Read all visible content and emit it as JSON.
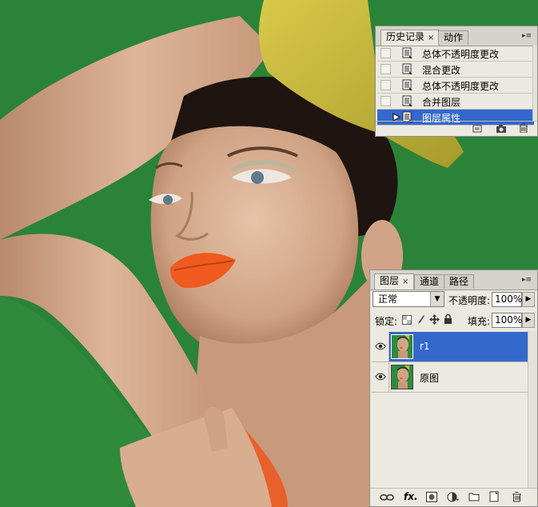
{
  "history_panel": {
    "tabs": [
      {
        "label": "历史记录",
        "close": "×"
      },
      {
        "label": "动作"
      }
    ],
    "menu_glyph": "▸≡",
    "collapse_glyph": "◂◂",
    "items": [
      {
        "label": "总体不透明度更改",
        "selected": false
      },
      {
        "label": "混合更改",
        "selected": false
      },
      {
        "label": "总体不透明度更改",
        "selected": false
      },
      {
        "label": "合并图层",
        "selected": false
      },
      {
        "label": "图层属性",
        "selected": true
      }
    ],
    "footer_icons": [
      "new-document-from-state-icon",
      "create-snapshot-icon",
      "delete-state-icon"
    ]
  },
  "layers_panel": {
    "tabs": [
      {
        "label": "图层",
        "close": "×"
      },
      {
        "label": "通道"
      },
      {
        "label": "路径"
      }
    ],
    "menu_glyph": "▸≡",
    "collapse_glyph": "◂◂",
    "blend_mode": "正常",
    "opacity_label": "不透明度:",
    "opacity_value": "100%",
    "lock_label": "锁定:",
    "fill_label": "填充:",
    "fill_value": "100%",
    "layers": [
      {
        "name": "r1",
        "selected": true,
        "visible": true
      },
      {
        "name": "原图",
        "selected": false,
        "visible": true
      }
    ],
    "footer_icons": [
      "link-layers-icon",
      "layer-style-icon",
      "layer-mask-icon",
      "adjustment-layer-icon",
      "new-group-icon",
      "new-layer-icon",
      "delete-layer-icon"
    ],
    "fx_label": "fx."
  },
  "colors": {
    "background_green": "#2f8a3c",
    "selection_blue": "#3468cc",
    "panel_bg": "#ece9e0",
    "lip_orange": "#f05a1e",
    "glove_yellow": "#c9b83c"
  }
}
